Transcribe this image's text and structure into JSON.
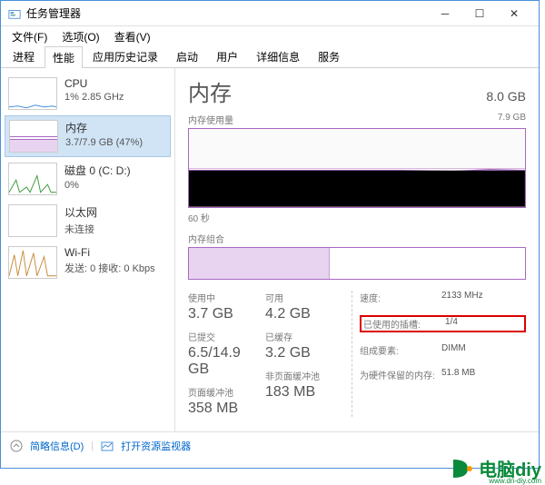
{
  "window": {
    "title": "任务管理器"
  },
  "menus": {
    "file": "文件(F)",
    "options": "选项(O)",
    "view": "查看(V)"
  },
  "tabs": [
    "进程",
    "性能",
    "应用历史记录",
    "启动",
    "用户",
    "详细信息",
    "服务"
  ],
  "sidebar": [
    {
      "label": "CPU",
      "sub": "1% 2.85 GHz"
    },
    {
      "label": "内存",
      "sub": "3.7/7.9 GB (47%)"
    },
    {
      "label": "磁盘 0 (C: D:)",
      "sub": "0%"
    },
    {
      "label": "以太网",
      "sub": "未连接"
    },
    {
      "label": "Wi-Fi",
      "sub": "发送: 0 接收: 0 Kbps"
    }
  ],
  "main": {
    "title": "内存",
    "total": "8.0 GB",
    "usage_label": "内存使用量",
    "usage_max": "7.9 GB",
    "axis_time": "60 秒",
    "composition_label": "内存组合"
  },
  "stats": {
    "inuse_label": "使用中",
    "inuse": "3.7 GB",
    "avail_label": "可用",
    "avail": "4.2 GB",
    "committed_label": "已提交",
    "committed": "6.5/14.9 GB",
    "cached_label": "已缓存",
    "cached": "3.2 GB",
    "paged_label": "页面缓冲池",
    "paged": "358 MB",
    "nonpaged_label": "非页面缓冲池",
    "nonpaged": "183 MB"
  },
  "info": {
    "speed_label": "速度:",
    "speed": "2133 MHz",
    "slots_label": "已使用的插槽:",
    "slots": "1/4",
    "form_label": "组成要素:",
    "form": "DIMM",
    "reserved_label": "为硬件保留的内存:",
    "reserved": "51.8 MB"
  },
  "footer": {
    "less": "简略信息(D)",
    "resmon": "打开资源监视器"
  },
  "watermark": {
    "text": "电脑diy",
    "url": "www.dn-diy.com"
  },
  "chart_data": {
    "type": "line",
    "title": "内存使用量",
    "xlabel": "60 秒",
    "ylabel": "",
    "ylim": [
      0,
      7.9
    ],
    "x_seconds": [
      60,
      55,
      50,
      45,
      40,
      35,
      30,
      25,
      20,
      15,
      10,
      5,
      0
    ],
    "values_gb": [
      3.7,
      3.7,
      3.7,
      3.7,
      3.7,
      3.7,
      3.7,
      3.7,
      3.7,
      3.7,
      3.7,
      3.7,
      3.7
    ],
    "composition": {
      "in_use_gb": 3.7,
      "available_gb": 4.2,
      "total_gb": 7.9
    }
  }
}
